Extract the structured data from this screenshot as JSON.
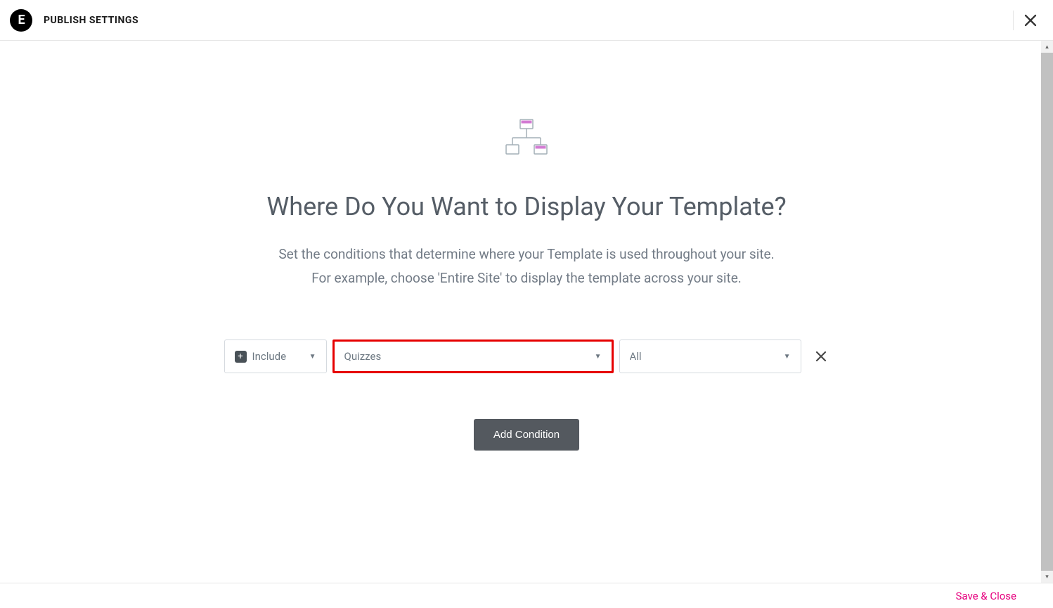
{
  "header": {
    "logo_text": "E",
    "title": "PUBLISH SETTINGS"
  },
  "hero": {
    "title": "Where Do You Want to Display Your Template?",
    "description_line1": "Set the conditions that determine where your Template is used throughout your site.",
    "description_line2": "For example, choose 'Entire Site' to display the template across your site."
  },
  "condition": {
    "mode": "Include",
    "location": "Quizzes",
    "filter": "All"
  },
  "actions": {
    "add_condition": "Add Condition",
    "save_close": "Save & Close"
  }
}
